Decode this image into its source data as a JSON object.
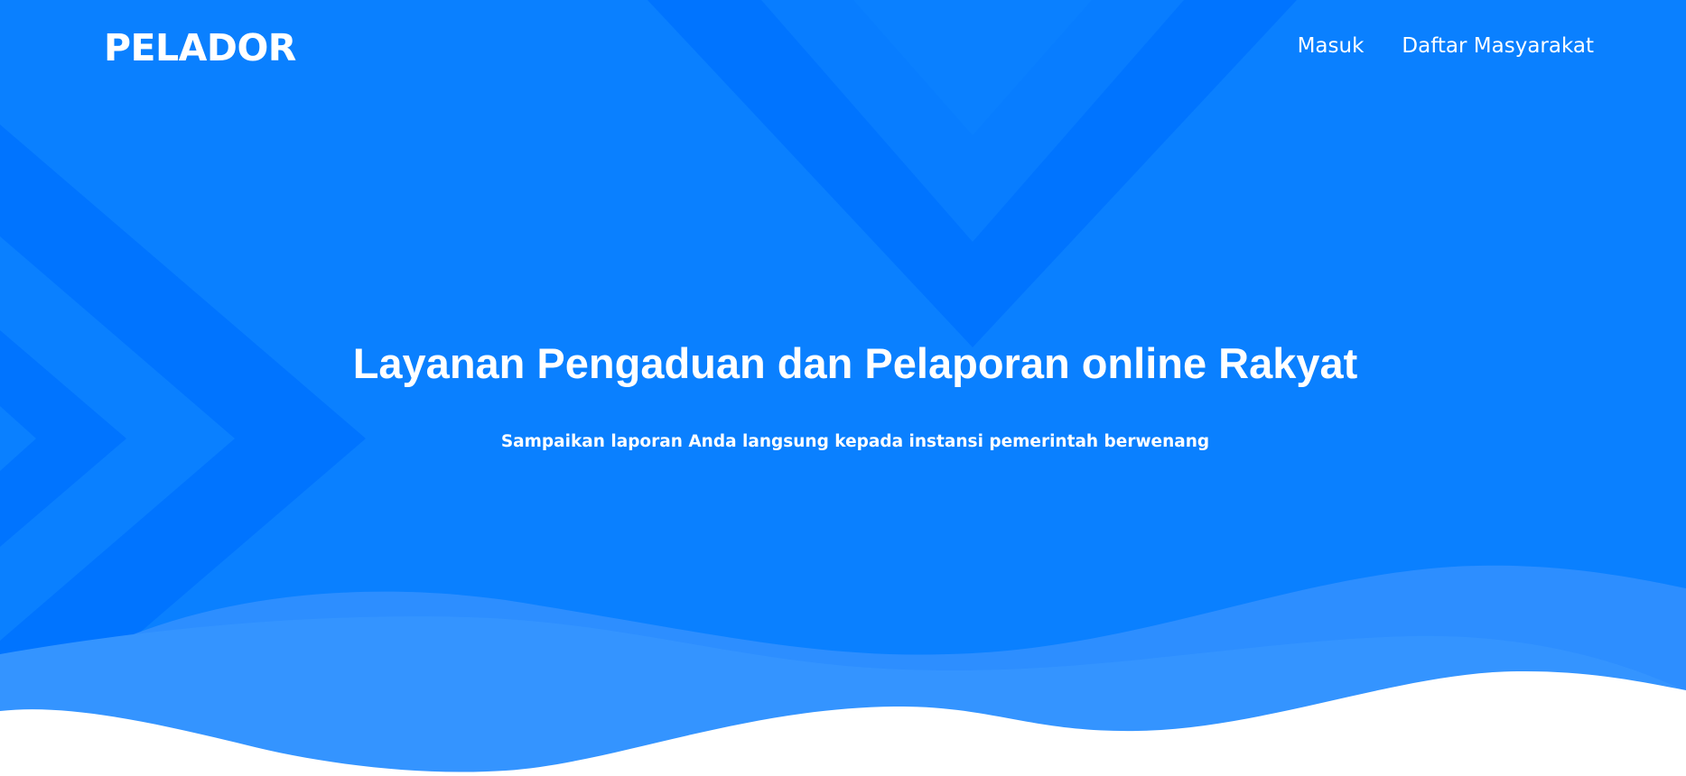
{
  "brand": {
    "name": "PELADOR"
  },
  "nav": {
    "items": [
      {
        "label": "Masuk"
      },
      {
        "label": "Daftar Masyarakat"
      }
    ]
  },
  "hero": {
    "title": "Layanan Pengaduan dan Pelaporan online Rakyat",
    "subtitle": "Sampaikan laporan Anda langsung kepada instansi pemerintah berwenang"
  },
  "colors": {
    "background": "#0a80ff",
    "pattern_dark": "#0071fe",
    "pattern_light": "#0b84ff",
    "wave_back": "#2d8eff",
    "wave_front": "#3494ff",
    "wave_bottom": "#ffffff",
    "text": "#ffffff"
  }
}
